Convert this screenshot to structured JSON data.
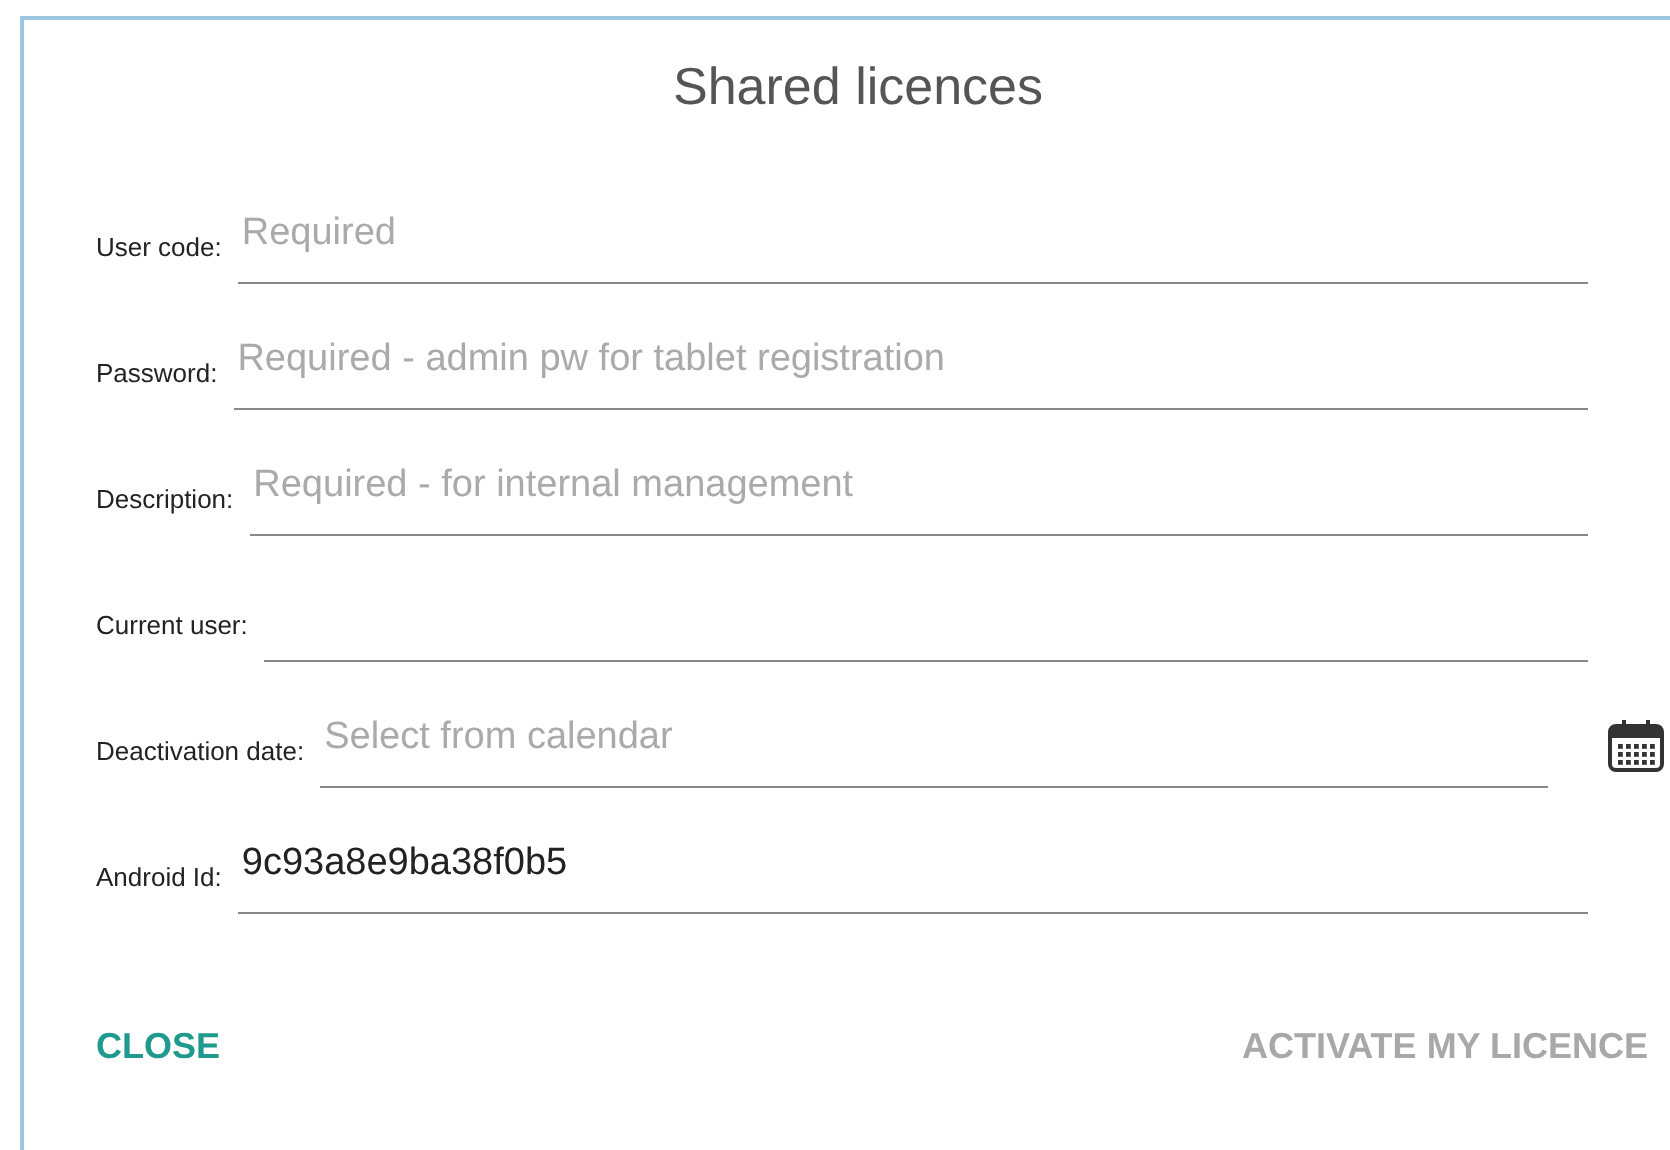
{
  "dialog": {
    "title": "Shared licences",
    "fields": [
      {
        "kind": "text",
        "label": "User code:",
        "placeholder": "Required"
      },
      {
        "kind": "text",
        "label": "Password:",
        "placeholder": "Required - admin pw for tablet registration"
      },
      {
        "kind": "text",
        "label": "Description:",
        "placeholder": "Required - for internal management"
      },
      {
        "kind": "text",
        "label": "Current user:"
      },
      {
        "kind": "date",
        "label": "Deactivation date:",
        "placeholder": "Select from calendar"
      },
      {
        "kind": "text",
        "label": "Android Id:",
        "value": "9c93a8e9ba38f0b5"
      }
    ],
    "buttons": [
      {
        "label": "CLOSE",
        "disabled": false
      },
      {
        "label": "ACTIVATE MY LICENCE",
        "disabled": true
      }
    ]
  }
}
